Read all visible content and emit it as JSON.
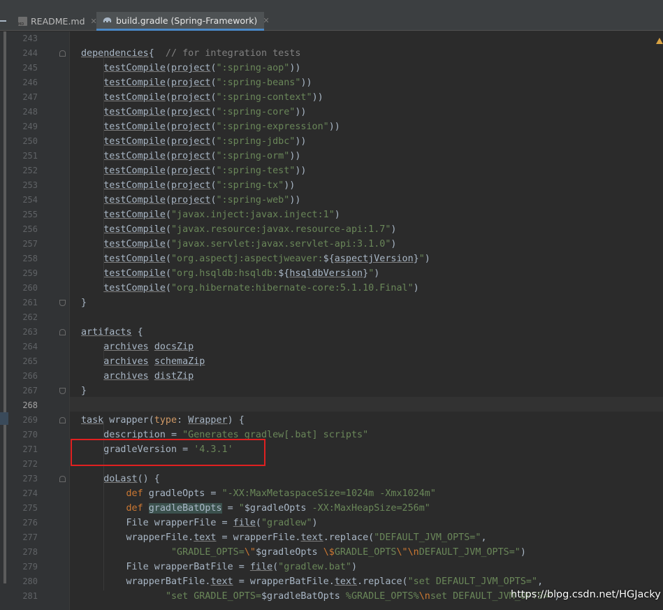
{
  "tabs": [
    {
      "label": "README.md",
      "icon": "markdown-file-icon",
      "active": false
    },
    {
      "label": "build.gradle (Spring-Framework)",
      "icon": "gradle-elephant-icon",
      "active": true
    }
  ],
  "watermark": "https://blog.csdn.net/HGJacky",
  "colors": {
    "keyword": "#cc7832",
    "string": "#6a8759",
    "comment": "#808080",
    "text": "#a9b7c6",
    "highlight_box": "#e02020"
  },
  "lines": [
    {
      "no": "243",
      "segs": []
    },
    {
      "no": "244",
      "segs": [
        [
          "u",
          "dependencies"
        ],
        [
          "",
          "{ "
        ],
        [
          "cm",
          " // for integration tests"
        ]
      ]
    },
    {
      "no": "245",
      "segs": [
        [
          "",
          "    "
        ],
        [
          "u",
          "testCompile"
        ],
        [
          "",
          "("
        ],
        [
          "u",
          "project"
        ],
        [
          "",
          "("
        ],
        [
          "str",
          "\":spring-aop\""
        ],
        [
          "",
          "))"
        ]
      ]
    },
    {
      "no": "246",
      "segs": [
        [
          "",
          "    "
        ],
        [
          "u",
          "testCompile"
        ],
        [
          "",
          "("
        ],
        [
          "u",
          "project"
        ],
        [
          "",
          "("
        ],
        [
          "str",
          "\":spring-beans\""
        ],
        [
          "",
          "))"
        ]
      ]
    },
    {
      "no": "247",
      "segs": [
        [
          "",
          "    "
        ],
        [
          "u",
          "testCompile"
        ],
        [
          "",
          "("
        ],
        [
          "u",
          "project"
        ],
        [
          "",
          "("
        ],
        [
          "str",
          "\":spring-context\""
        ],
        [
          "",
          "))"
        ]
      ]
    },
    {
      "no": "248",
      "segs": [
        [
          "",
          "    "
        ],
        [
          "u",
          "testCompile"
        ],
        [
          "",
          "("
        ],
        [
          "u",
          "project"
        ],
        [
          "",
          "("
        ],
        [
          "str",
          "\":spring-core\""
        ],
        [
          "",
          "))"
        ]
      ]
    },
    {
      "no": "249",
      "segs": [
        [
          "",
          "    "
        ],
        [
          "u",
          "testCompile"
        ],
        [
          "",
          "("
        ],
        [
          "u",
          "project"
        ],
        [
          "",
          "("
        ],
        [
          "str",
          "\":spring-expression\""
        ],
        [
          "",
          "))"
        ]
      ]
    },
    {
      "no": "250",
      "segs": [
        [
          "",
          "    "
        ],
        [
          "u",
          "testCompile"
        ],
        [
          "",
          "("
        ],
        [
          "u",
          "project"
        ],
        [
          "",
          "("
        ],
        [
          "str",
          "\":spring-jdbc\""
        ],
        [
          "",
          "))"
        ]
      ]
    },
    {
      "no": "251",
      "segs": [
        [
          "",
          "    "
        ],
        [
          "u",
          "testCompile"
        ],
        [
          "",
          "("
        ],
        [
          "u",
          "project"
        ],
        [
          "",
          "("
        ],
        [
          "str",
          "\":spring-orm\""
        ],
        [
          "",
          "))"
        ]
      ]
    },
    {
      "no": "252",
      "segs": [
        [
          "",
          "    "
        ],
        [
          "u",
          "testCompile"
        ],
        [
          "",
          "("
        ],
        [
          "u",
          "project"
        ],
        [
          "",
          "("
        ],
        [
          "str",
          "\":spring-test\""
        ],
        [
          "",
          "))"
        ]
      ]
    },
    {
      "no": "253",
      "segs": [
        [
          "",
          "    "
        ],
        [
          "u",
          "testCompile"
        ],
        [
          "",
          "("
        ],
        [
          "u",
          "project"
        ],
        [
          "",
          "("
        ],
        [
          "str",
          "\":spring-tx\""
        ],
        [
          "",
          "))"
        ]
      ]
    },
    {
      "no": "254",
      "segs": [
        [
          "",
          "    "
        ],
        [
          "u",
          "testCompile"
        ],
        [
          "",
          "("
        ],
        [
          "u",
          "project"
        ],
        [
          "",
          "("
        ],
        [
          "str",
          "\":spring-web\""
        ],
        [
          "",
          "))"
        ]
      ]
    },
    {
      "no": "255",
      "segs": [
        [
          "",
          "    "
        ],
        [
          "u",
          "testCompile"
        ],
        [
          "",
          "("
        ],
        [
          "str",
          "\"javax.inject:javax.inject:1\""
        ],
        [
          "",
          ")"
        ]
      ]
    },
    {
      "no": "256",
      "segs": [
        [
          "",
          "    "
        ],
        [
          "u",
          "testCompile"
        ],
        [
          "",
          "("
        ],
        [
          "str",
          "\"javax.resource:javax.resource-api:1.7\""
        ],
        [
          "",
          ")"
        ]
      ]
    },
    {
      "no": "257",
      "segs": [
        [
          "",
          "    "
        ],
        [
          "u",
          "testCompile"
        ],
        [
          "",
          "("
        ],
        [
          "str",
          "\"javax.servlet:javax.servlet-api:3.1.0\""
        ],
        [
          "",
          ")"
        ]
      ]
    },
    {
      "no": "258",
      "segs": [
        [
          "",
          "    "
        ],
        [
          "u",
          "testCompile"
        ],
        [
          "",
          "("
        ],
        [
          "str",
          "\"org.aspectj:aspectjweaver:"
        ],
        [
          "",
          "${"
        ],
        [
          "u",
          "aspectjVersion"
        ],
        [
          "",
          "}"
        ],
        [
          "str",
          "\""
        ],
        [
          "",
          ")"
        ]
      ]
    },
    {
      "no": "259",
      "segs": [
        [
          "",
          "    "
        ],
        [
          "u",
          "testCompile"
        ],
        [
          "",
          "("
        ],
        [
          "str",
          "\"org.hsqldb:hsqldb:"
        ],
        [
          "",
          "${"
        ],
        [
          "u",
          "hsqldbVersion"
        ],
        [
          "",
          "}"
        ],
        [
          "str",
          "\""
        ],
        [
          "",
          ")"
        ]
      ]
    },
    {
      "no": "260",
      "segs": [
        [
          "",
          "    "
        ],
        [
          "u",
          "testCompile"
        ],
        [
          "",
          "("
        ],
        [
          "str",
          "\"org.hibernate:hibernate-core:5.1.10.Final\""
        ],
        [
          "",
          ")"
        ]
      ]
    },
    {
      "no": "261",
      "segs": [
        [
          "",
          "}"
        ]
      ]
    },
    {
      "no": "262",
      "segs": []
    },
    {
      "no": "263",
      "segs": [
        [
          "u",
          "artifacts"
        ],
        [
          "",
          " {"
        ]
      ]
    },
    {
      "no": "264",
      "segs": [
        [
          "",
          "    "
        ],
        [
          "u",
          "archives"
        ],
        [
          "",
          " "
        ],
        [
          "u",
          "docsZip"
        ]
      ]
    },
    {
      "no": "265",
      "segs": [
        [
          "",
          "    "
        ],
        [
          "u",
          "archives"
        ],
        [
          "",
          " "
        ],
        [
          "u",
          "schemaZip"
        ]
      ]
    },
    {
      "no": "266",
      "segs": [
        [
          "",
          "    "
        ],
        [
          "u",
          "archives"
        ],
        [
          "",
          " "
        ],
        [
          "u",
          "distZip"
        ]
      ]
    },
    {
      "no": "267",
      "segs": [
        [
          "",
          "}"
        ]
      ]
    },
    {
      "no": "268",
      "segs": []
    },
    {
      "no": "269",
      "segs": [
        [
          "u",
          "task"
        ],
        [
          "",
          " wrapper("
        ],
        [
          "par",
          "type"
        ],
        [
          "",
          ": "
        ],
        [
          "u",
          "Wrapper"
        ],
        [
          "",
          ") {"
        ]
      ]
    },
    {
      "no": "270",
      "segs": [
        [
          "",
          "    description = "
        ],
        [
          "str",
          "\"Generates gradlew[.bat] scripts\""
        ]
      ]
    },
    {
      "no": "271",
      "segs": [
        [
          "",
          "    gradleVersion = "
        ],
        [
          "str",
          "'4.3.1'"
        ]
      ]
    },
    {
      "no": "272",
      "segs": []
    },
    {
      "no": "273",
      "segs": [
        [
          "",
          "    "
        ],
        [
          "u",
          "doLast"
        ],
        [
          "",
          "() {"
        ]
      ]
    },
    {
      "no": "274",
      "segs": [
        [
          "",
          "        "
        ],
        [
          "kw",
          "def"
        ],
        [
          "",
          " gradleOpts = "
        ],
        [
          "str",
          "\"-XX:MaxMetaspaceSize=1024m -Xmx1024m\""
        ]
      ]
    },
    {
      "no": "275",
      "segs": [
        [
          "",
          "        "
        ],
        [
          "kw",
          "def"
        ],
        [
          "",
          " "
        ],
        [
          "bat",
          "gradleBatOpts"
        ],
        [
          "",
          " = "
        ],
        [
          "str",
          "\""
        ],
        [
          "",
          "$gradleOpts"
        ],
        [
          "str",
          " -XX:MaxHeapSize=256m\""
        ]
      ]
    },
    {
      "no": "276",
      "segs": [
        [
          "",
          "        File wrapperFile = "
        ],
        [
          "u",
          "file"
        ],
        [
          "",
          "("
        ],
        [
          "str",
          "\"gradlew\""
        ],
        [
          "",
          ")"
        ]
      ]
    },
    {
      "no": "277",
      "segs": [
        [
          "",
          "        wrapperFile."
        ],
        [
          "u",
          "text"
        ],
        [
          "",
          " = wrapperFile."
        ],
        [
          "u",
          "text"
        ],
        [
          "",
          ".replace("
        ],
        [
          "str",
          "\"DEFAULT_JVM_OPTS=\""
        ],
        [
          "",
          ","
        ]
      ]
    },
    {
      "no": "278",
      "segs": [
        [
          "",
          "                "
        ],
        [
          "str",
          "\"GRADLE_OPTS="
        ],
        [
          "esc",
          "\\\""
        ],
        [
          "",
          "$gradleOpts "
        ],
        [
          "esc",
          "\\$"
        ],
        [
          "str",
          "GRADLE_OPTS"
        ],
        [
          "esc",
          "\\\""
        ],
        [
          "esc",
          "\\n"
        ],
        [
          "str",
          "DEFAULT_JVM_OPTS=\""
        ],
        [
          "",
          ")"
        ]
      ]
    },
    {
      "no": "279",
      "segs": [
        [
          "",
          "        File wrapperBatFile = "
        ],
        [
          "u",
          "file"
        ],
        [
          "",
          "("
        ],
        [
          "str",
          "\"gradlew.bat\""
        ],
        [
          "",
          ")"
        ]
      ]
    },
    {
      "no": "280",
      "segs": [
        [
          "",
          "        wrapperBatFile."
        ],
        [
          "u",
          "text"
        ],
        [
          "",
          " = wrapperBatFile."
        ],
        [
          "u",
          "text"
        ],
        [
          "",
          ".replace("
        ],
        [
          "str",
          "\"set DEFAULT_JVM_OPTS=\""
        ],
        [
          "",
          ","
        ]
      ]
    },
    {
      "no": "281",
      "segs": [
        [
          "",
          "               "
        ],
        [
          "str",
          "\"set GRADLE_OPTS="
        ],
        [
          "",
          "$gradleBatOpts"
        ],
        [
          "str",
          " %GRADLE_OPTS%"
        ],
        [
          "esc",
          "\\n"
        ],
        [
          "str",
          "set DEFAULT_JVM_OPTS=\""
        ],
        [
          "",
          ")"
        ]
      ]
    }
  ]
}
